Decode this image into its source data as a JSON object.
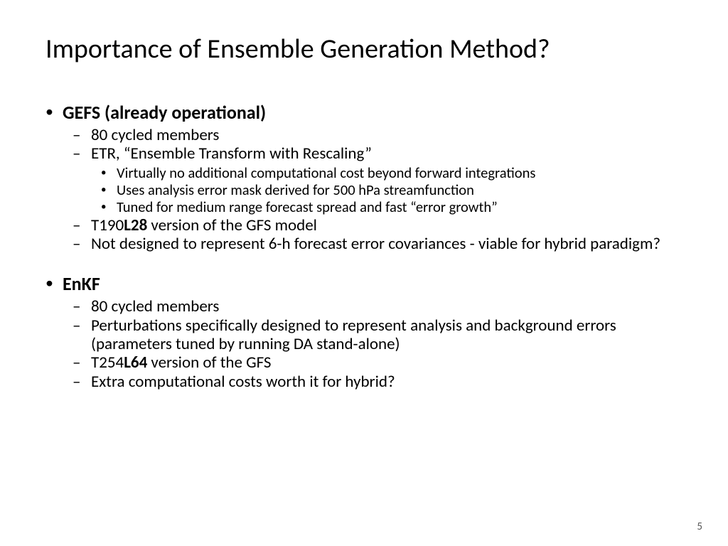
{
  "title": "Importance of Ensemble Generation Method?",
  "s1": {
    "head": "GEFS (already operational)",
    "a": "80 cycled members",
    "b": "ETR, “Ensemble Transform with Rescaling”",
    "b1": "Virtually no additional computational cost beyond forward integrations",
    "b2": "Uses analysis error mask derived for 500 hPa streamfunction",
    "b3_pre": "Tuned for medium range forecast spread and fast ",
    "b3_q": "“error growth”",
    "c_pre": "T190",
    "c_bold": "L28",
    "c_post": " version of the GFS model",
    "d": "Not designed to represent 6-h forecast error covariances - viable for hybrid paradigm?"
  },
  "s2": {
    "head": "EnKF",
    "a": "80 cycled members",
    "b": "Perturbations specifically designed to represent analysis and background errors (parameters tuned by running DA stand-alone)",
    "c_pre": "T254",
    "c_bold": "L64",
    "c_post": " version of the GFS",
    "d": "Extra computational costs worth it for hybrid?"
  },
  "page": "5"
}
